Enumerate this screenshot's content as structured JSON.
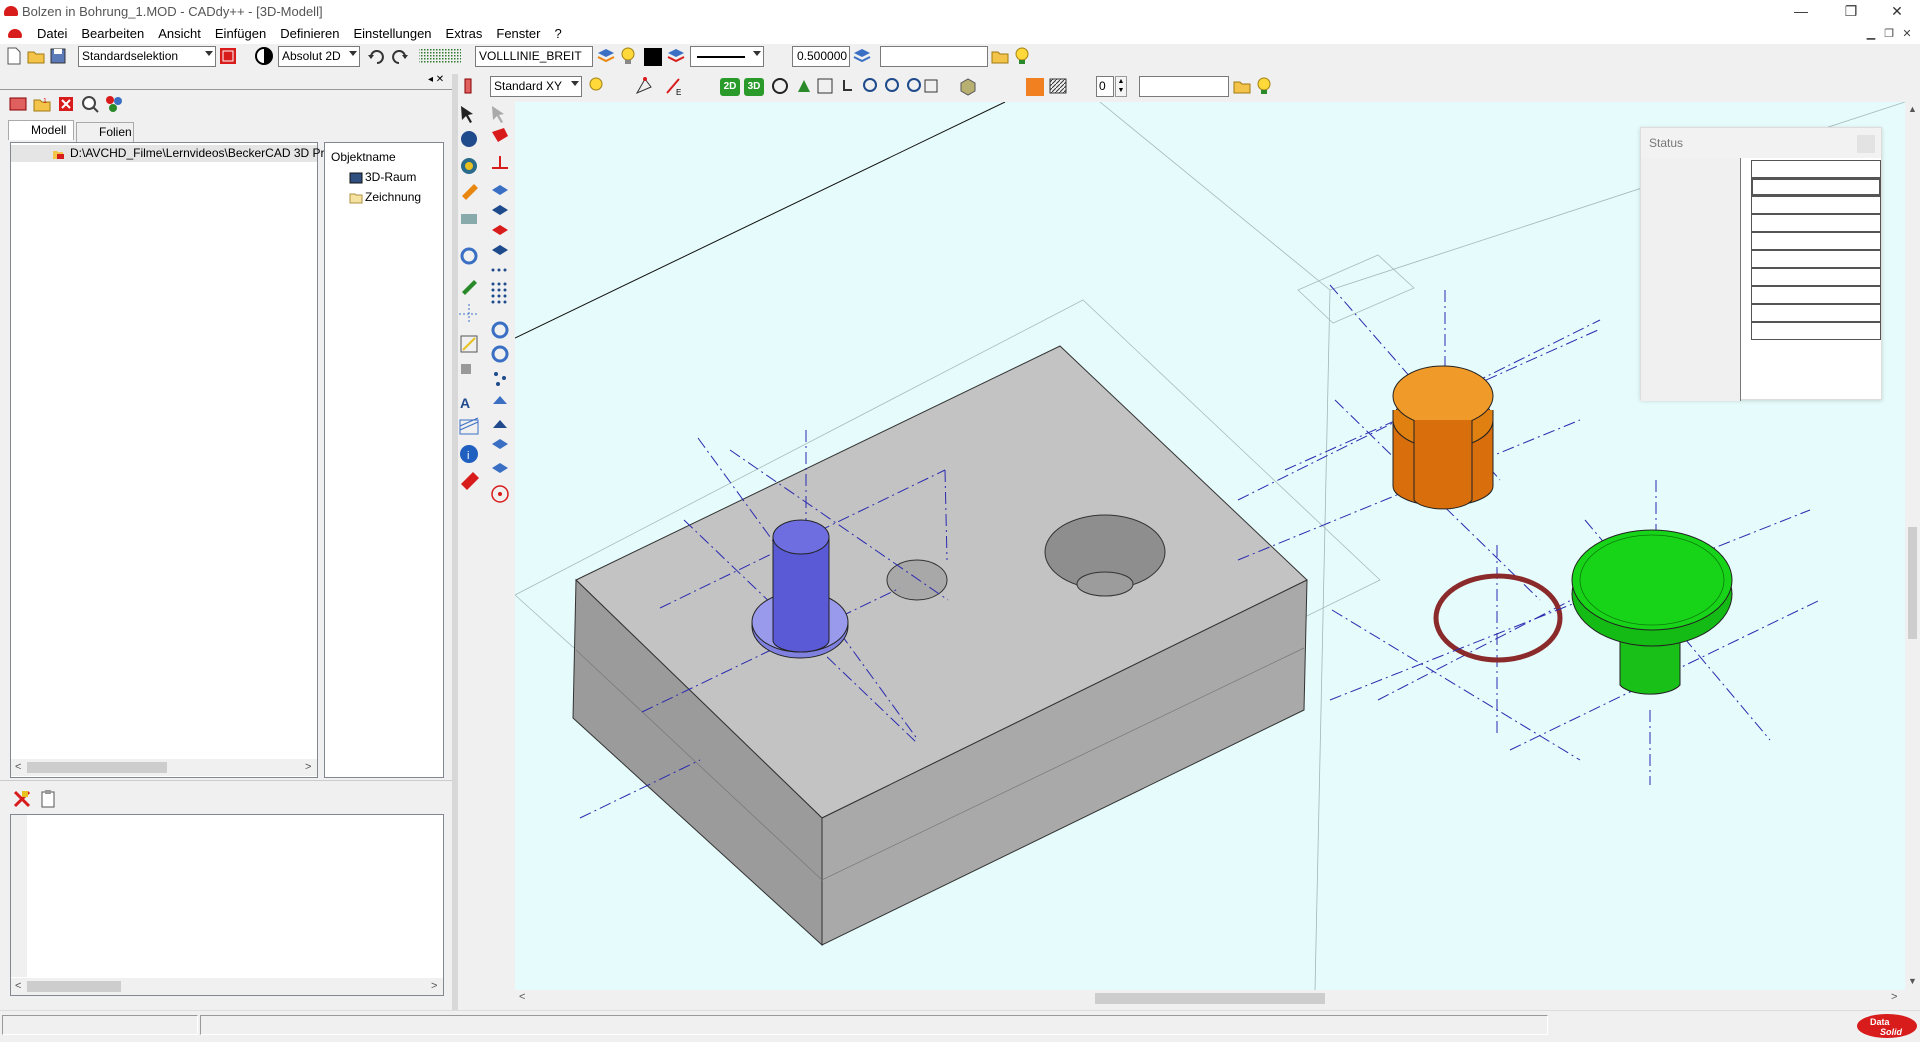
{
  "window": {
    "title": "Bolzen in Bohrung_1.MOD  -  CADdy++ - [3D-Modell]",
    "minimize_symbol": "—",
    "restore_symbol": "❐",
    "close_symbol": "✕"
  },
  "menu": {
    "items": [
      "Datei",
      "Bearbeiten",
      "Ansicht",
      "Einfügen",
      "Definieren",
      "Einstellungen",
      "Extras",
      "Fenster",
      "?"
    ]
  },
  "toolbar_top": {
    "selection_mode": "Standardselektion",
    "coordinate_mode": "Absolut 2D",
    "line_type": "VOLLLINIE_BREIT",
    "line_width": "0.500000",
    "search_value": ""
  },
  "toolbar_view": {
    "view_plane": "Standard XY",
    "btn_2d": "2D",
    "btn_3d": "3D",
    "layer_value": "0",
    "extra_value": ""
  },
  "left_panel": {
    "tabs": [
      "Modell",
      "Folien"
    ],
    "active_tab": "Modell",
    "tree_path": "D:\\AVCHD_Filme\\Lernvideos\\BeckerCAD 3D Pr",
    "object_header": "Objektname",
    "objects": [
      "3D-Raum",
      "Zeichnung"
    ]
  },
  "status_window": {
    "title": "Status",
    "rows": [
      "",
      "",
      "",
      "",
      "",
      "",
      "",
      "",
      "",
      ""
    ]
  },
  "colors": {
    "viewport_bg": "#e6fbfb",
    "block_top": "#c3c3c3",
    "block_front": "#9b9b9b",
    "block_side": "#a9a9a9",
    "pin_blue": "#5a5ad6",
    "pin_orange": "#e8860f",
    "pin_green": "#18d418",
    "oring": "#8b2a2a",
    "axis_line": "#2a2ab0",
    "accent_red": "#d81b1b"
  },
  "brand": {
    "logo_text_top": "Data",
    "logo_text_bottom": "Solid"
  }
}
